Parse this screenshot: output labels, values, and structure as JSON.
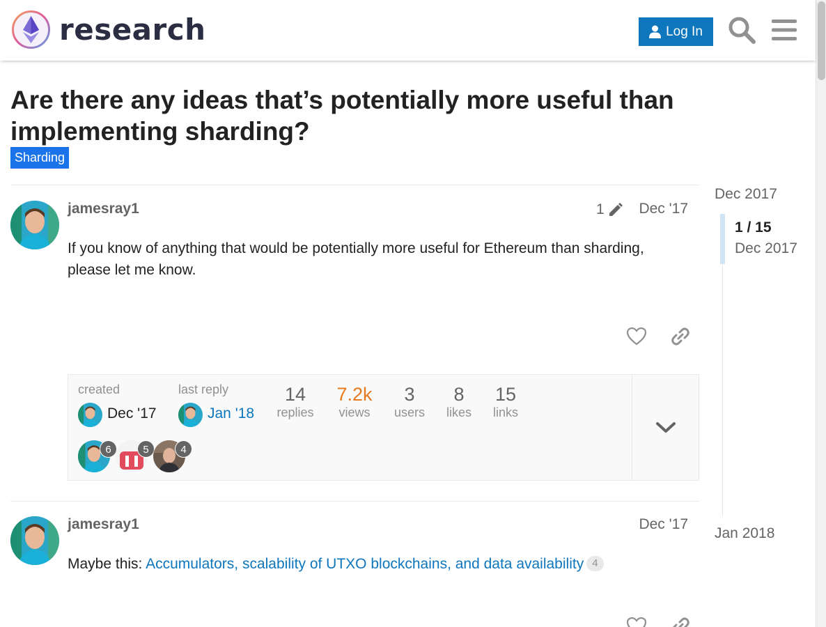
{
  "header": {
    "site_name": "research",
    "login_label": "Log In",
    "search_icon": "search-icon",
    "menu_icon": "hamburger-menu-icon"
  },
  "topic": {
    "title": "Are there any ideas that’s potentially more useful than implementing sharding?",
    "category": "Sharding",
    "category_color": "#1a73e8"
  },
  "posts": [
    {
      "username": "jamesray1",
      "edit_count": "1",
      "date": "Dec '17",
      "body": "If you know of anything that would be potentially more useful for Ethereum than sharding, please let me know."
    },
    {
      "username": "jamesray1",
      "date": "Dec '17",
      "body_prefix": "Maybe this:",
      "link_text": "Accumulators, scalability of UTXO blockchains, and data availability",
      "link_clicks": "4"
    }
  ],
  "topic_map": {
    "created_label": "created",
    "created_date": "Dec '17",
    "last_reply_label": "last reply",
    "last_reply_date": "Jan '18",
    "stats": [
      {
        "value": "14",
        "label": "replies"
      },
      {
        "value": "7.2k",
        "label": "views"
      },
      {
        "value": "3",
        "label": "users"
      },
      {
        "value": "8",
        "label": "likes"
      },
      {
        "value": "15",
        "label": "links"
      }
    ],
    "participants": [
      {
        "count": "6"
      },
      {
        "count": "5"
      },
      {
        "count": "4"
      }
    ]
  },
  "timeline": {
    "start_date": "Dec 2017",
    "position": "1 / 15",
    "position_date": "Dec 2017",
    "end_date": "Jan 2018"
  },
  "colors": {
    "accent": "#0e76bd",
    "views_highlight": "#e7791e"
  }
}
